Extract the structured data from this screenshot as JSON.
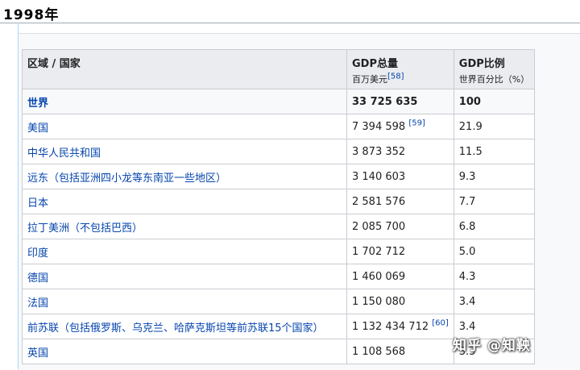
{
  "page": {
    "title": "1998年"
  },
  "table": {
    "headers": [
      {
        "main": "区域 / 国家",
        "sub": "",
        "ref": ""
      },
      {
        "main": "GDP总量",
        "sub": "百万美元",
        "ref": "[58]"
      },
      {
        "main": "GDP比例",
        "sub": "世界百分比（%）",
        "ref": ""
      }
    ],
    "rows": [
      {
        "region": "世界",
        "gdp": "33 725 635",
        "ref": "",
        "share": "100"
      },
      {
        "region": "美国",
        "gdp": "7 394 598",
        "ref": "[59]",
        "share": "21.9"
      },
      {
        "region": "中华人民共和国",
        "gdp": "3 873 352",
        "ref": "",
        "share": "11.5"
      },
      {
        "region": "远东（包括亚洲四小龙等东南亚一些地区）",
        "gdp": "3 140 603",
        "ref": "",
        "share": "9.3"
      },
      {
        "region": "日本",
        "gdp": "2 581 576",
        "ref": "",
        "share": "7.7"
      },
      {
        "region": "拉丁美洲（不包括巴西）",
        "gdp": "2 085 700",
        "ref": "",
        "share": "6.8"
      },
      {
        "region": "印度",
        "gdp": "1 702 712",
        "ref": "",
        "share": "5.0"
      },
      {
        "region": "德国",
        "gdp": "1 460 069",
        "ref": "",
        "share": "4.3"
      },
      {
        "region": "法国",
        "gdp": "1 150 080",
        "ref": "",
        "share": "3.4"
      },
      {
        "region": "前苏联（包括俄罗斯、乌克兰、哈萨克斯坦等前苏联15个国家）",
        "gdp": "1 132 434 712",
        "ref": "[60]",
        "share": "3.4"
      },
      {
        "region": "英国",
        "gdp": "1 108 568",
        "ref": "",
        "share": "3.3"
      }
    ]
  },
  "watermark": "知乎 @知鞅"
}
